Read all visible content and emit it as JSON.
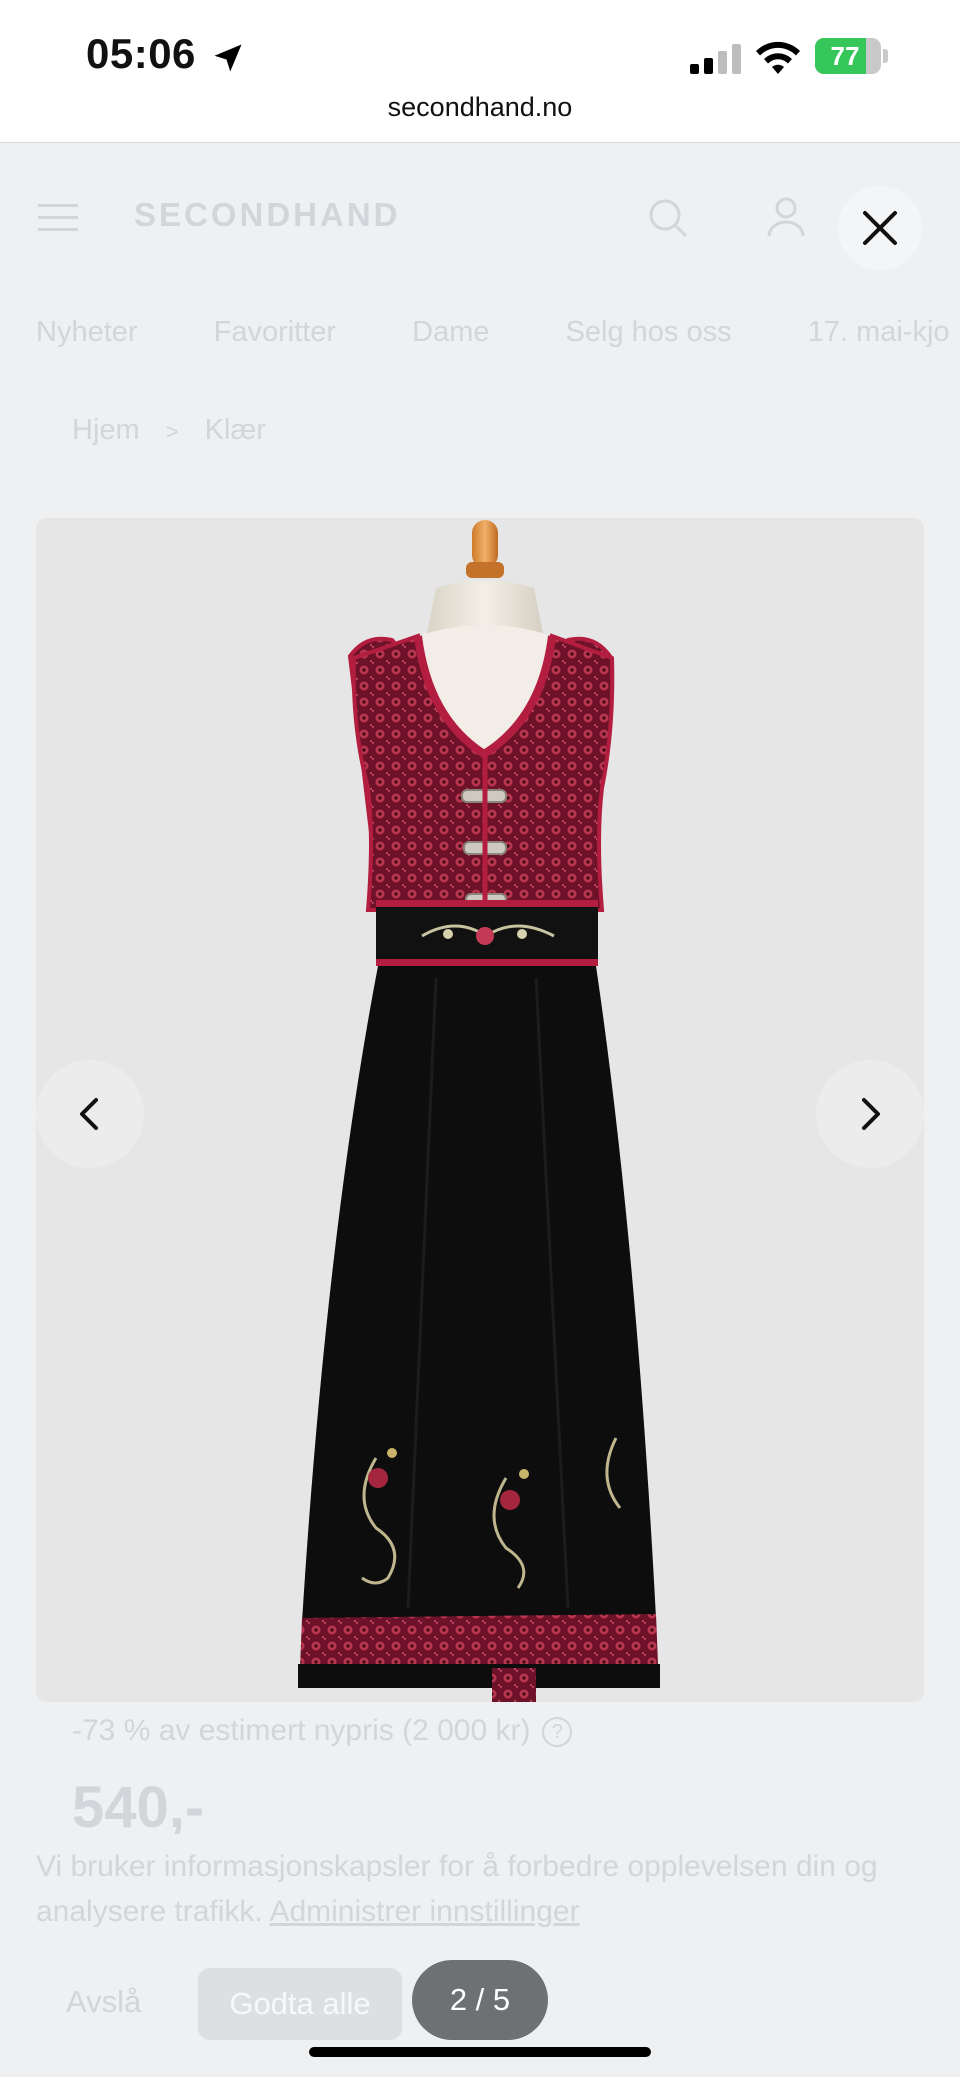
{
  "status_bar": {
    "time": "05:06",
    "battery_percent": 77,
    "battery_label": "77",
    "url": "secondhand.no"
  },
  "site": {
    "logo": "SECONDHAND",
    "nav_items": [
      "Nyheter",
      "Favoritter",
      "Dame",
      "Selg hos oss",
      "17. mai-kjo"
    ],
    "breadcrumb": [
      "Hjem",
      "Klær"
    ],
    "discount_text": "-73 % av estimert nypris (2 000 kr)",
    "price": "540,-",
    "cookie": {
      "text": "Vi bruker informasjonskapsler for å forbedre opplevelsen din og analysere trafikk.",
      "link": "Administrer innstillinger",
      "decline": "Avslå",
      "accept": "Godta alle"
    }
  },
  "viewer": {
    "counter": "2 / 5",
    "current": 2,
    "total": 5
  },
  "icons": {
    "close": "close-icon",
    "prev": "chevron-left-icon",
    "next": "chevron-right-icon",
    "location": "location-arrow-icon"
  },
  "colors": {
    "battery": "#35c759",
    "dress_bodice": "#8e1f3a",
    "dress_skirt": "#0d0d0d",
    "counter_pill": "#6e7173"
  }
}
